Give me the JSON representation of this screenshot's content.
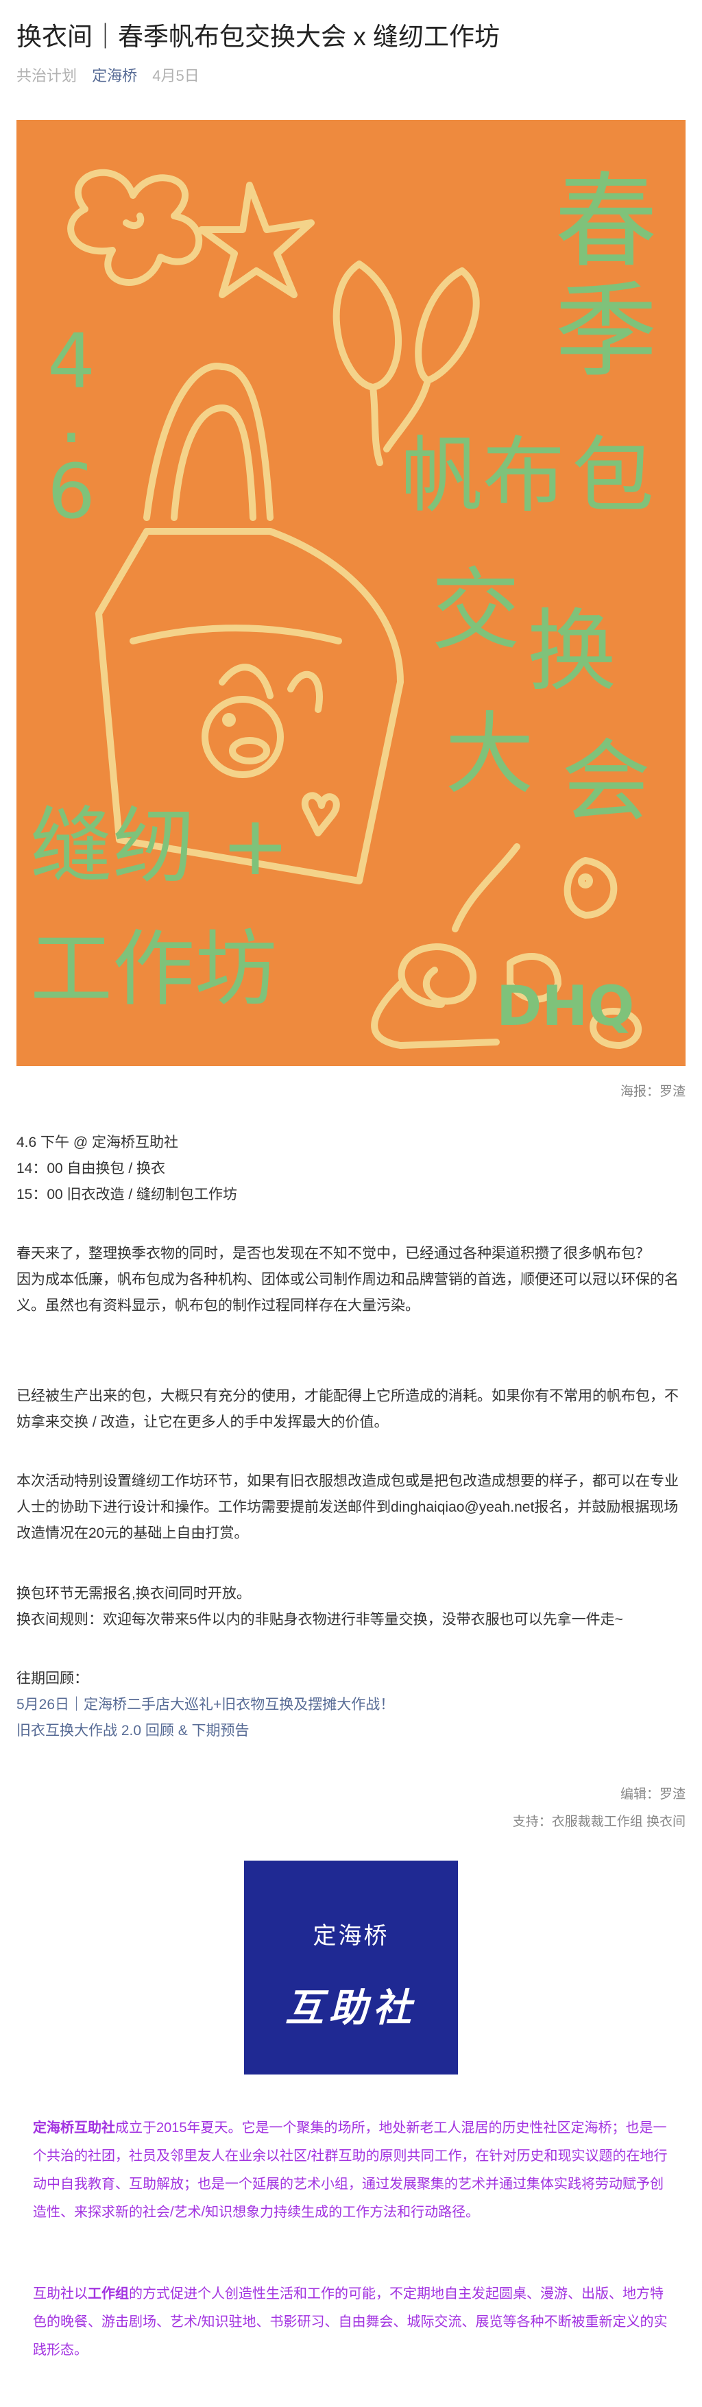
{
  "article": {
    "title": "换衣间｜春季帆布包交换大会 x 缝纫工作坊",
    "meta": {
      "account": "共治计划",
      "author": "定海桥",
      "date": "4月5日"
    }
  },
  "poster": {
    "title_chars": [
      "春",
      "季",
      "帆",
      "布",
      "包",
      "交",
      "换",
      "大",
      "会"
    ],
    "date_chars": [
      "4",
      ".",
      "6"
    ],
    "workshop_row1": "缝纫 +",
    "workshop_row2": "工作坊",
    "signature": "DHQ",
    "colors": {
      "background": "#ee8a3e",
      "green": "#7fc27a",
      "yellow": "#f4d38a"
    },
    "caption": "海报：罗渣"
  },
  "schedule": [
    "4.6 下午 @ 定海桥互助社",
    "14：00  自由换包 / 换衣",
    "15：00  旧衣改造 / 缝纫制包工作坊"
  ],
  "body": [
    "春天来了，整理换季衣物的同时，是否也发现在不知不觉中，已经通过各种渠道积攒了很多帆布包？",
    "因为成本低廉，帆布包成为各种机构、团体或公司制作周边和品牌营销的首选，顺便还可以冠以环保的名义。虽然也有资料显示，帆布包的制作过程同样存在大量污染。",
    "已经被生产出来的包，大概只有充分的使用，才能配得上它所造成的消耗。如果你有不常用的帆布包，不妨拿来交换 / 改造，让它在更多人的手中发挥最大的价值。",
    "本次活动特别设置缝纫工作坊环节，如果有旧衣服想改造成包或是把包改造成想要的样子，都可以在专业人士的协助下进行设计和操作。工作坊需要提前发送邮件到dinghaiqiao@yeah.net报名，并鼓励根据现场改造情况在20元的基础上自由打赏。",
    "换包环节无需报名,换衣间同时开放。",
    "换衣间规则：欢迎每次带来5件以内的非贴身衣物进行非等量交换，没带衣服也可以先拿一件走~"
  ],
  "review": {
    "heading": "往期回顾：",
    "links": [
      "5月26日｜定海桥二手店大巡礼+旧衣物互换及摆摊大作战！",
      "旧衣互换大作战 2.0 回顾 & 下期预告"
    ]
  },
  "credits": {
    "editor": "编辑：罗渣",
    "support": "支持：衣服裁裁工作组 换衣间"
  },
  "logo": {
    "line1": "定海桥",
    "line2": "互助社"
  },
  "about": {
    "p1_bold": "定海桥互助社",
    "p1_rest": "成立于2015年夏天。它是一个聚集的场所，地处新老工人混居的历史性社区定海桥；也是一个共治的社团，社员及邻里友人在业余以社区/社群互助的原则共同工作，在针对历史和现实议题的在地行动中自我教育、互助解放；也是一个延展的艺术小组，通过发展聚集的艺术并通过集体实践将劳动赋予创造性、来探求新的社会/艺术/知识想象力持续生成的工作方法和行动路径。",
    "p2_a": "互助社以",
    "p2_bold": "工作组",
    "p2_rest": "的方式促进个人创造性生活和工作的可能，不定期地自主发起圆桌、漫游、出版、地方特色的晚餐、游击剧场、艺术/知识驻地、书影研习、自由舞会、城际交流、展览等各种不断被重新定义的实践形态。"
  }
}
